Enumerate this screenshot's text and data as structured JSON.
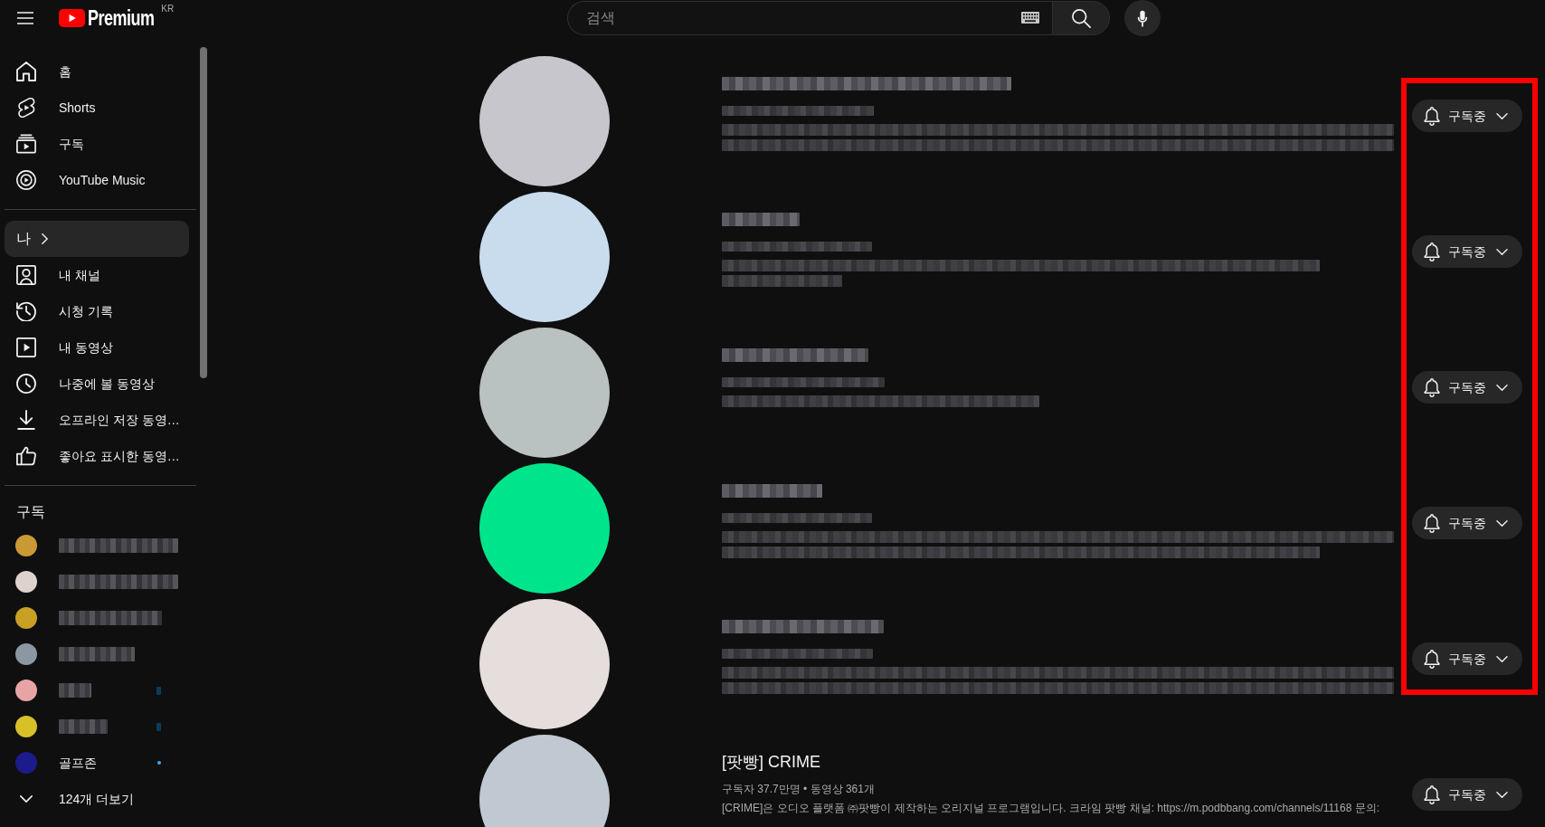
{
  "topbar": {
    "logo_text": "Premium",
    "country": "KR",
    "search": {
      "placeholder": "검색"
    }
  },
  "sidebar": {
    "primary": [
      {
        "label": "홈",
        "selected": false
      },
      {
        "label": "Shorts",
        "selected": false
      },
      {
        "label": "구독",
        "selected": false
      },
      {
        "label": "YouTube Music",
        "selected": false
      }
    ],
    "you": {
      "label": "나",
      "selected": true
    },
    "library": [
      {
        "label": "내 채널",
        "selected": false
      },
      {
        "label": "시청 기록",
        "selected": false
      },
      {
        "label": "내 동영상",
        "selected": false
      },
      {
        "label": "나중에 볼 동영상",
        "selected": false
      },
      {
        "label": "오프라인 저장 동영…",
        "selected": false
      },
      {
        "label": "좋아요 표시한 동영…",
        "selected": false
      }
    ],
    "subscriptions": {
      "heading": "구독",
      "items": [
        {
          "kind": "redacted",
          "color": "#c99a34",
          "new_content": false
        },
        {
          "kind": "redacted",
          "color": "#ddd3cc",
          "new_content": false
        },
        {
          "kind": "redacted",
          "color": "#c8a024",
          "new_content": false
        },
        {
          "kind": "redacted",
          "color": "#8c97a4",
          "new_content": false
        },
        {
          "kind": "redacted",
          "color": "#e8a4a4",
          "new_content": true
        },
        {
          "kind": "redacted",
          "color": "#d8c028",
          "new_content": true
        },
        {
          "kind": "channel",
          "name": "골프존",
          "color": "#1b1b8c",
          "new_content": true
        }
      ],
      "more": "124개 더보기"
    }
  },
  "channels": [
    {
      "kind": "redacted",
      "color": "#c6c6cc",
      "button": "구독중",
      "highlighted": true
    },
    {
      "kind": "redacted",
      "color": "#c9dcee",
      "button": "구독중",
      "highlighted": true
    },
    {
      "kind": "redacted",
      "color": "#b9c1c1",
      "button": "구독중",
      "highlighted": true
    },
    {
      "kind": "redacted",
      "color": "#00e58c",
      "button": "구독중",
      "highlighted": true
    },
    {
      "kind": "redacted",
      "color": "#e6dddd",
      "button": "구독중",
      "highlighted": true
    },
    {
      "kind": "channel",
      "color": "#c0c8d2",
      "title": "[팟빵] CRIME",
      "meta": "구독자 37.7만명 • 동영상 361개",
      "description": "[CRIME]은 오디오 플랫폼 ㈜팟빵이 제작하는 오리지널 프로그램입니다. 크라임 팟빵 채널: https://m.podbbang.com/channels/11168 문의:",
      "button": "구독중",
      "highlighted": false
    }
  ]
}
